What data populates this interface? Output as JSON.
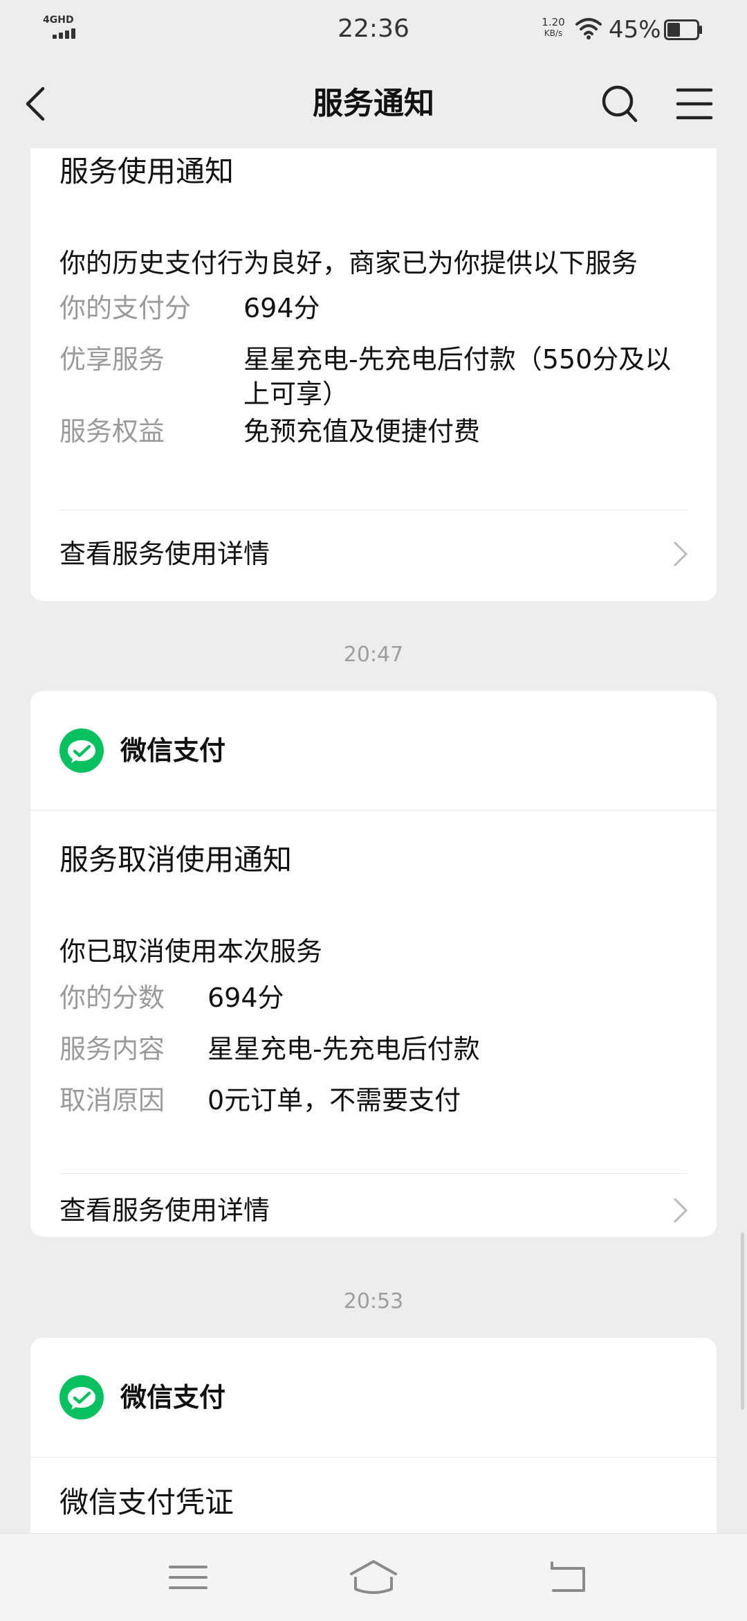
{
  "status_bar": {
    "network": "4GHD",
    "time": "22:36",
    "speed_value": "1.20",
    "speed_unit": "KB/s",
    "battery_percent": "45%",
    "battery_level": 0.45
  },
  "header": {
    "title": "服务通知",
    "icons": {
      "back": "chevron-left-icon",
      "search": "search-icon",
      "menu": "menu-icon"
    }
  },
  "messages": [
    {
      "title": "服务使用通知",
      "intro": "你的历史支付行为良好，商家已为你提供以下服务",
      "rows": [
        {
          "label": "你的支付分",
          "value": "694分"
        },
        {
          "label": "优享服务",
          "value": "星星充电-先充电后付款（550分及以上可享）"
        },
        {
          "label": "服务权益",
          "value": "免预充值及便捷付费"
        }
      ],
      "link": "查看服务使用详情"
    },
    {
      "time": "20:47",
      "source": "微信支付",
      "title": "服务取消使用通知",
      "intro": "你已取消使用本次服务",
      "rows": [
        {
          "label": "你的分数",
          "value": "694分"
        },
        {
          "label": "服务内容",
          "value": "星星充电-先充电后付款"
        },
        {
          "label": "取消原因",
          "value": "0元订单，不需要支付"
        }
      ],
      "link": "查看服务使用详情"
    },
    {
      "time": "20:53",
      "source": "微信支付",
      "title": "微信支付凭证"
    }
  ],
  "colors": {
    "background": "#ededed",
    "card": "#ffffff",
    "wechat_pay_green": "#07c160",
    "muted_text": "#9a9a9a"
  },
  "nav_bar": {
    "icons": [
      "menu-icon",
      "home-icon",
      "back-icon"
    ]
  }
}
